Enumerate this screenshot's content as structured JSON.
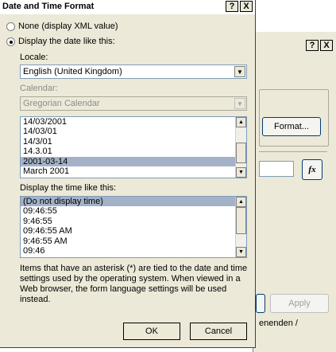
{
  "dialog": {
    "title": "Date and Time Format",
    "help_btn": "?",
    "close_btn": "X"
  },
  "options": {
    "none_label": "None (display XML value)",
    "display_date_label": "Display the date like this:"
  },
  "locale": {
    "label": "Locale:",
    "value": "English (United Kingdom)"
  },
  "calendar": {
    "label": "Calendar:",
    "value": "Gregorian Calendar"
  },
  "date_formats": [
    "14/03/2001",
    "14/03/01",
    "14/3/01",
    "14.3.01",
    "2001-03-14",
    "March 2001"
  ],
  "time": {
    "label": "Display the time like this:",
    "formats": [
      "(Do not display time)",
      "09:46:55",
      "9:46:55",
      "09:46:55 AM",
      "9:46:55 AM",
      "09:46"
    ]
  },
  "note": "Items that have an asterisk (*) are tied to the date and time settings used by the operating system. When viewed in a Web browser, the form language settings will be used instead.",
  "buttons": {
    "ok": "OK",
    "cancel": "Cancel"
  },
  "background": {
    "format_btn": "Format...",
    "fx_btn": "fx",
    "apply_btn": "Apply",
    "help_btn": "?",
    "close_btn": "X",
    "partial_text": "enenden /"
  }
}
